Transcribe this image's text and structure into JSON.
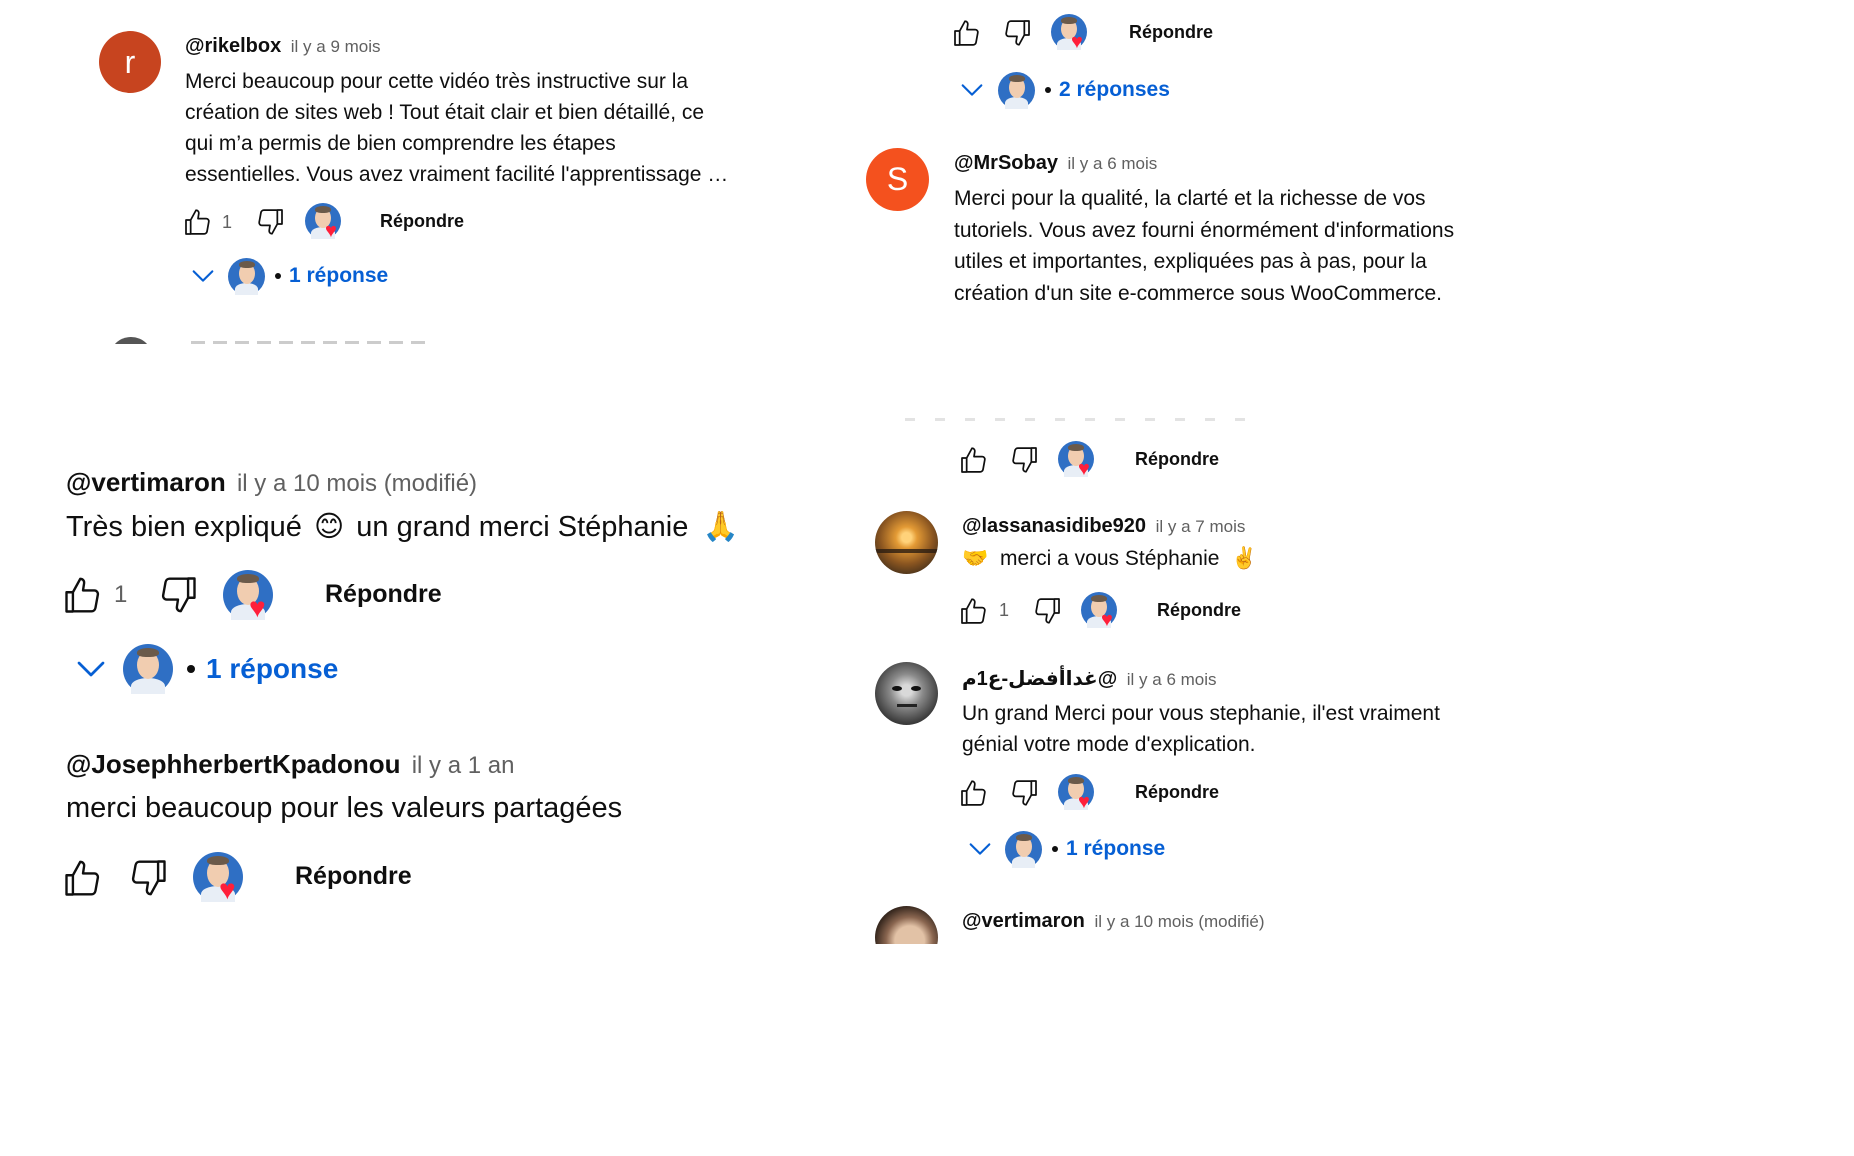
{
  "reply_label": "Répondre",
  "comments": {
    "rikelbox": {
      "avatar_letter": "r",
      "handle": "@rikelbox",
      "time": "il y a 9 mois",
      "text_lines": [
        "Merci beaucoup pour cette vidéo très instructive sur la",
        "création de sites web ! Tout était clair et bien détaillé, ce",
        "qui m’a permis de bien comprendre les étapes",
        "essentielles. Vous avez vraiment facilité l'apprentissage …"
      ],
      "likes": "1",
      "replies": "1 réponse"
    },
    "top_right": {
      "replies": "2 réponses"
    },
    "mrsobay": {
      "avatar_letter": "S",
      "handle": "@MrSobay",
      "time": "il y a 6 mois",
      "text_lines": [
        "Merci pour la qualité, la clarté et la richesse de vos",
        "tutoriels. Vous avez fourni énormément d'informations",
        "utiles et importantes, expliquées pas à pas, pour la",
        "création d'un site e-commerce sous WooCommerce."
      ]
    },
    "vertimaron_big": {
      "handle": "@vertimaron",
      "time": "il y a 10 mois (modifié)",
      "text_before": "Très bien expliqué",
      "emoji1": "😊",
      "text_after": "un grand merci Stéphanie",
      "emoji2": "🙏",
      "likes": "1",
      "replies": "1 réponse"
    },
    "joseph": {
      "handle": "@JosephherbertKpadonou",
      "time": "il y a 1 an",
      "text": "merci beaucoup pour les valeurs partagées"
    },
    "lassana": {
      "handle": "@lassanasidibe920",
      "time": "il y a 7 mois",
      "emoji1": "🤝",
      "text": "merci a vous Stéphanie",
      "emoji2": "✌️",
      "likes": "1"
    },
    "arabic": {
      "handle": "@غداأفضل-ع1م",
      "time": "il y a 6 mois",
      "text_lines": [
        "Un grand Merci pour vous stephanie, il'est vraiment",
        "génial votre mode d'explication."
      ],
      "replies": "1 réponse"
    },
    "vertimaron_small": {
      "handle": "@vertimaron",
      "time": "il y a 10 mois (modifié)"
    }
  },
  "colors": {
    "link_blue": "#065fd4",
    "avatar_r": "#c7441f",
    "avatar_s": "#f4511e",
    "creator_ring": "#2f6fc4",
    "heart": "#ff1f3a",
    "meta_gray": "#606060"
  }
}
